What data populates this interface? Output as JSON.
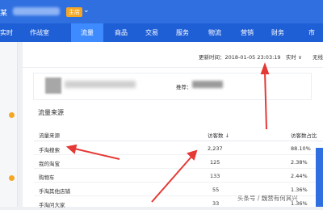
{
  "header": {
    "shop_name_fragment": "某",
    "shop_badge": "主店",
    "nav_items": [
      {
        "label": "实时"
      },
      {
        "label": "作战室"
      },
      {
        "label": "流量"
      },
      {
        "label": "商品"
      },
      {
        "label": "交易"
      },
      {
        "label": "服务"
      },
      {
        "label": "物流"
      },
      {
        "label": "营销"
      },
      {
        "label": "财务"
      },
      {
        "label": "市"
      }
    ]
  },
  "filter": {
    "update_time": "更新时间：2018-01-05 23:03:19",
    "realtime": "实时 ∨",
    "no_wireless": "无线"
  },
  "item": {
    "recommend_label": "推荐："
  },
  "traffic": {
    "section_title": "流量来源",
    "columns": [
      "流量来源",
      "访客数 ↓",
      "访客数占比"
    ],
    "rows": [
      {
        "source": "手淘搜索",
        "visitors": "2,237",
        "ratio": "88.10%"
      },
      {
        "source": "我的淘宝",
        "visitors": "125",
        "ratio": "2.38%"
      },
      {
        "source": "购物车",
        "visitors": "133",
        "ratio": "2.44%"
      },
      {
        "source": "手淘其他店铺",
        "visitors": "55",
        "ratio": "1.36%"
      },
      {
        "source": "手淘问大家",
        "visitors": "33",
        "ratio": "1.36%"
      }
    ]
  },
  "watermark": "头条号 / 魏营有何其兴",
  "colors": {
    "brand": "#2f6fe0",
    "nav": "#1f5fd6",
    "arrow": "#e53935",
    "badge": "#f5a623"
  }
}
